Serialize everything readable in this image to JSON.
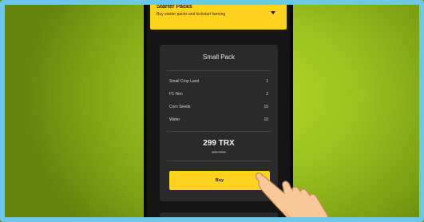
{
  "header": {
    "title": "Starter Packs",
    "subtitle": "Buy starter packs and kickstart farming"
  },
  "pack": {
    "title": "Small Pack",
    "items": [
      {
        "name": "Small Crop Land",
        "qty": "1"
      },
      {
        "name": "P1 Hen",
        "qty": "2"
      },
      {
        "name": "Corn Seeds",
        "qty": "10"
      },
      {
        "name": "Water",
        "qty": "10"
      }
    ],
    "price": "299 TRX",
    "old_price": "329 TRX",
    "buy_label": "Buy"
  },
  "icons": {
    "dropdown": "chevron-down-icon",
    "pointer": "hand-pointer-icon"
  },
  "colors": {
    "accent": "#ffd21e",
    "card": "#2a2a2a",
    "panel": "#151515"
  }
}
